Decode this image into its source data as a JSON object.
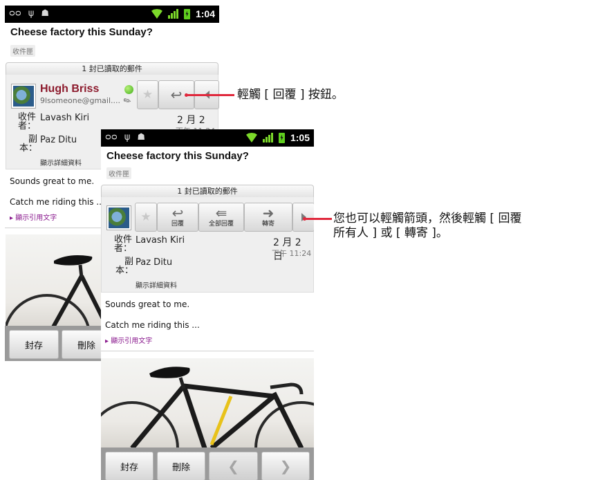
{
  "back_screen": {
    "status_time": "1:04",
    "subject": "Cheese factory this Sunday?",
    "folder": "收件匣",
    "read_banner": "1 封已讀取的郵件",
    "sender_name": "Hugh Briss",
    "sender_email": "9lsomeone@gmail....",
    "to_label": "收件者：",
    "to_value": "Lavash Kiri",
    "cc_label": "副本：",
    "cc_value": "Paz Ditu",
    "date": "2 月 2 日",
    "time": "下午 11:24",
    "show_details": "顯示詳細資料",
    "body_line1": "Sounds great to me.",
    "body_line2": "Catch me riding this ...",
    "show_quoted": "▸ 顯示引用文字",
    "archive_label": "封存",
    "delete_label": "刪除"
  },
  "front_screen": {
    "status_time": "1:05",
    "subject": "Cheese factory this Sunday?",
    "folder": "收件匣",
    "read_banner": "1 封已讀取的郵件",
    "reply_label": "回覆",
    "reply_all_label": "全部回覆",
    "forward_label": "轉寄",
    "to_label": "收件者：",
    "to_value": "Lavash Kiri",
    "cc_label": "副本：",
    "cc_value": "Paz Ditu",
    "date": "2 月 2 日",
    "time": "下午 11:24",
    "show_details": "顯示詳細資料",
    "body_line1": "Sounds great to me.",
    "body_line2": "Catch me riding this ...",
    "show_quoted": "▸ 顯示引用文字",
    "archive_label": "封存",
    "delete_label": "刪除"
  },
  "callouts": {
    "reply_tip": "輕觸 [ 回覆 ] 按鈕。",
    "more_tip_line1": "您也可以輕觸箭頭，然後輕觸 [ 回覆",
    "more_tip_line2": "所有人 ] 或 [ 轉寄 ]。"
  },
  "colors": {
    "callout": "#e0283c",
    "sender_name": "#8c1a2c",
    "quoted_link": "#8a1a8e",
    "status_green": "#7cd92a"
  }
}
